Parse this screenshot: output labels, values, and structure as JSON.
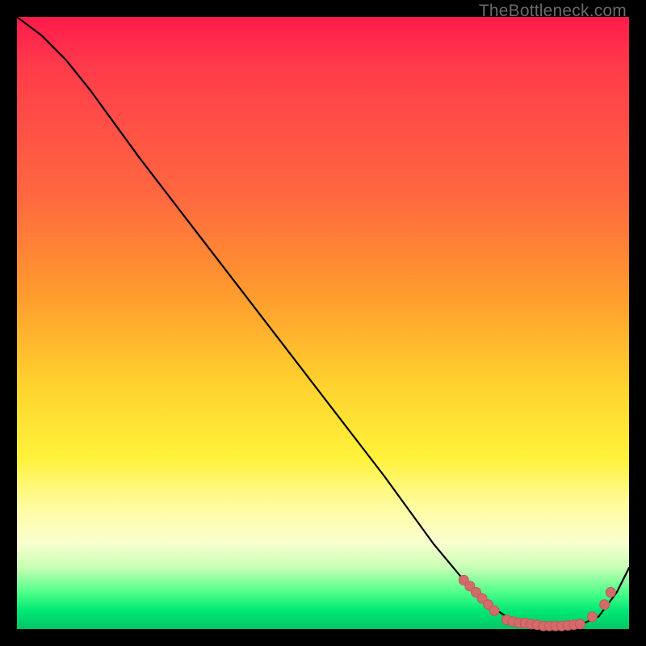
{
  "watermark": "TheBottleneck.com",
  "palette": {
    "curve_stroke": "#000000",
    "marker_fill": "#d46a6a",
    "marker_stroke": "#c05858"
  },
  "chart_data": {
    "type": "line",
    "title": "",
    "xlabel": "",
    "ylabel": "",
    "xlim": [
      0,
      100
    ],
    "ylim": [
      0,
      100
    ],
    "grid": false,
    "legend": false,
    "series": [
      {
        "name": "curve",
        "x": [
          0,
          4,
          8,
          12,
          20,
          30,
          40,
          50,
          60,
          68,
          73,
          77,
          80,
          83,
          86,
          89,
          92,
          95,
          98,
          100
        ],
        "y": [
          100,
          97,
          93,
          88,
          77,
          64,
          51,
          38,
          25,
          14,
          8,
          4,
          2,
          1,
          0.5,
          0.5,
          0.7,
          2,
          6,
          10
        ]
      }
    ],
    "markers": [
      {
        "x": 73,
        "y": 8
      },
      {
        "x": 74,
        "y": 7
      },
      {
        "x": 75,
        "y": 6
      },
      {
        "x": 76,
        "y": 5
      },
      {
        "x": 77,
        "y": 4
      },
      {
        "x": 78,
        "y": 3
      },
      {
        "x": 80,
        "y": 1.5
      },
      {
        "x": 81,
        "y": 1.2
      },
      {
        "x": 82,
        "y": 1
      },
      {
        "x": 83,
        "y": 1
      },
      {
        "x": 84,
        "y": 0.8
      },
      {
        "x": 85,
        "y": 0.7
      },
      {
        "x": 86,
        "y": 0.5
      },
      {
        "x": 87,
        "y": 0.5
      },
      {
        "x": 88,
        "y": 0.5
      },
      {
        "x": 89,
        "y": 0.5
      },
      {
        "x": 90,
        "y": 0.6
      },
      {
        "x": 91,
        "y": 0.7
      },
      {
        "x": 92,
        "y": 0.8
      },
      {
        "x": 94,
        "y": 2
      },
      {
        "x": 96,
        "y": 4
      },
      {
        "x": 97,
        "y": 6
      }
    ]
  }
}
